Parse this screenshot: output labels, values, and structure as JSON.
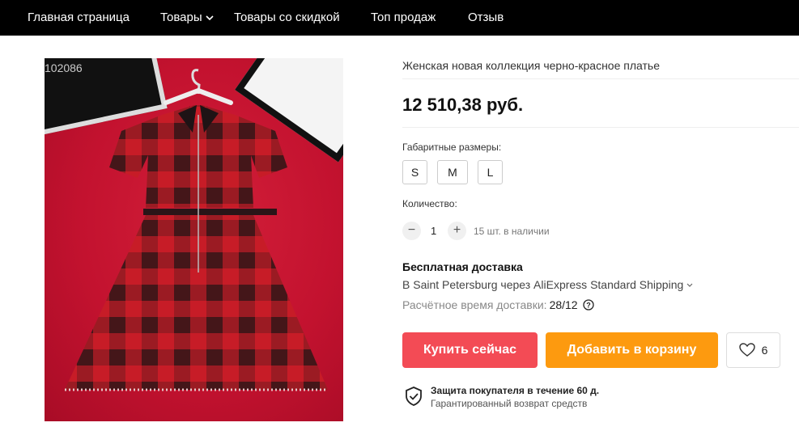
{
  "nav": {
    "items": [
      {
        "label": "Главная страница"
      },
      {
        "label": "Товары",
        "has_dropdown": true
      },
      {
        "label": "Товары со скидкой"
      },
      {
        "label": "Топ продаж"
      },
      {
        "label": "Отзыв"
      }
    ]
  },
  "product": {
    "image_code": "102086",
    "title": "Женская новая коллекция черно-красное платье",
    "price": "12 510,38 руб.",
    "sizes_label": "Габаритные размеры:",
    "sizes": [
      "S",
      "M",
      "L"
    ],
    "quantity_label": "Количество:",
    "quantity_value": "1",
    "stock_text": "15 шт. в наличии"
  },
  "shipping": {
    "title": "Бесплатная доставка",
    "line": "В Saint Petersburg через AliExpress Standard Shipping",
    "eta_label": "Расчётное время доставки:",
    "eta_value": "28/12"
  },
  "actions": {
    "buy_now": "Купить сейчас",
    "add_to_cart": "Добавить в корзину",
    "wishlist_count": "6"
  },
  "protection": {
    "title": "Защита покупателя в течение 60 д.",
    "subtitle": "Гарантированный возврат средств"
  },
  "colors": {
    "nav_bg": "#000000",
    "buy_button": "#f34b55",
    "cart_button": "#fd9a0f"
  }
}
